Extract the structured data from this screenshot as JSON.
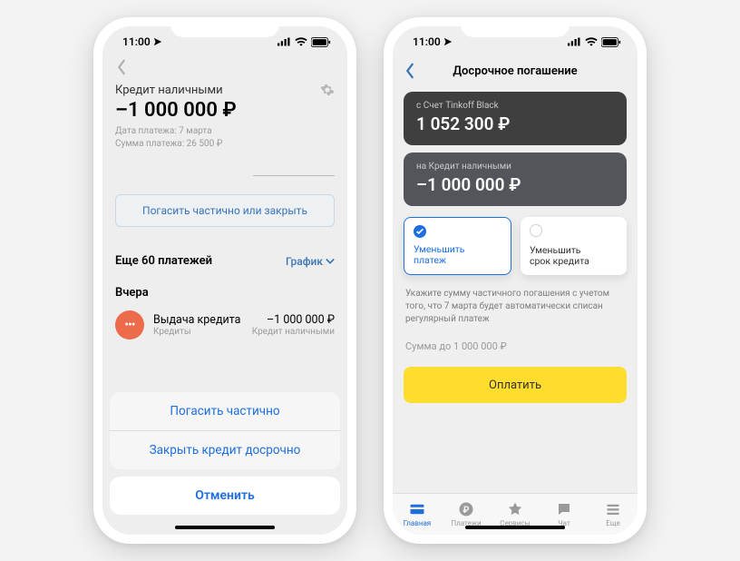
{
  "statusbar": {
    "time": "11:00"
  },
  "phone1": {
    "title": "Кредит наличными",
    "balance": "–1 000 000 ₽",
    "due_date_label": "Дата платежа: 7 марта",
    "due_amount_label": "Сумма платежа: 26 500 ₽",
    "repay_button": "Погасить частично или закрыть",
    "remaining_label": "Еще 60 платежей",
    "schedule_link": "График",
    "section_yesterday": "Вчера",
    "txn": {
      "title": "Выдача кредита",
      "subtitle": "Кредиты",
      "amount": "–1 000 000 ₽",
      "amount_sub": "Кредит наличными"
    },
    "sheet": {
      "opt1": "Погасить частично",
      "opt2": "Закрыть кредит досрочно",
      "cancel": "Отменить"
    }
  },
  "phone2": {
    "header": "Досрочное погашение",
    "from_card": {
      "label": "с Счет Tinkoff Black",
      "value": "1 052 300 ₽"
    },
    "to_card": {
      "label": "на Кредит наличными",
      "value": "–1 000 000 ₽"
    },
    "choice1": "Уменьшить\nплатеж",
    "choice2": "Уменьшить\nсрок кредита",
    "hint": "Укажите сумму частичного погашения с учетом того, что 7 марта будет автоматически списан регулярный платеж",
    "amount_placeholder": "Сумма до 1 000 000 ₽",
    "pay": "Оплатить",
    "tabs": [
      "Главная",
      "Платежи",
      "Сервисы",
      "Чат",
      "Еще"
    ]
  }
}
